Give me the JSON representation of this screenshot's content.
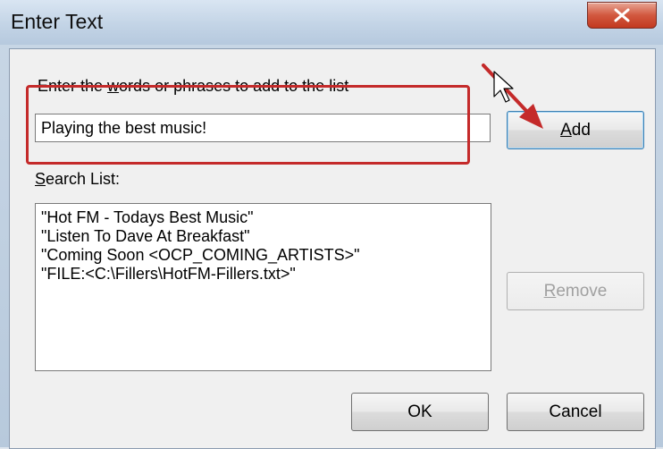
{
  "window": {
    "title": "Enter Text",
    "close_glyph": "X"
  },
  "prompt_label": {
    "before": "Enter the ",
    "accel": "w",
    "after": "ords or phrases to add to the list"
  },
  "input": {
    "value": "Playing the best music!"
  },
  "search_list_label": {
    "accel": "S",
    "after": "earch List:"
  },
  "search_list": [
    "\"Hot FM - Todays Best Music\"",
    "\"Listen To Dave At Breakfast\"",
    "\"Coming Soon <OCP_COMING_ARTISTS>\"",
    "\"FILE:<C:\\Fillers\\HotFM-Fillers.txt>\""
  ],
  "buttons": {
    "add": {
      "accel": "A",
      "after": "dd"
    },
    "remove": {
      "accel": "R",
      "after": "emove",
      "enabled": false
    },
    "ok": "OK",
    "cancel": "Cancel"
  },
  "annotation": {
    "color": "#c42a2a"
  }
}
